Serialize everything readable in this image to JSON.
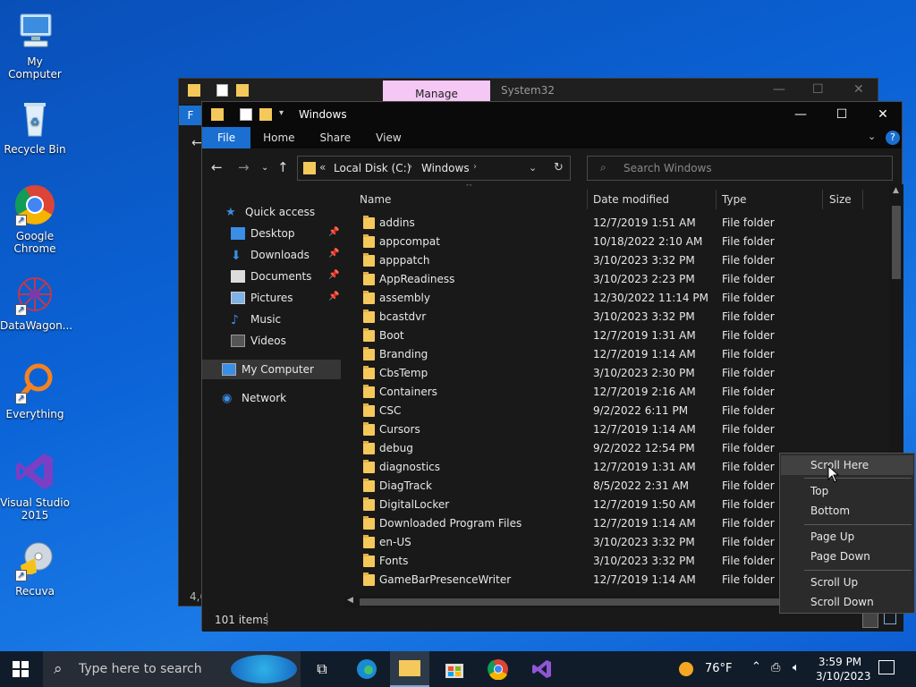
{
  "desktop": {
    "icons": [
      {
        "label": "My Computer",
        "icon": "monitor-icon"
      },
      {
        "label": "Recycle Bin",
        "icon": "recycle-bin-icon"
      },
      {
        "label": "Google Chrome",
        "icon": "chrome-icon"
      },
      {
        "label": "DataWagon...",
        "icon": "datawagon-icon"
      },
      {
        "label": "Everything",
        "icon": "everything-search-icon"
      },
      {
        "label": "Visual Studio 2015",
        "icon": "visual-studio-icon"
      },
      {
        "label": "Recuva",
        "icon": "recuva-icon"
      }
    ]
  },
  "background_window": {
    "manage_tab": "Manage",
    "title": "System32",
    "ribbon_file": "F",
    "status_fragment": "4,6"
  },
  "window": {
    "title": "Windows",
    "ribbon_tabs": [
      "File",
      "Home",
      "Share",
      "View"
    ],
    "breadcrumb": {
      "prefix": "«",
      "items": [
        "Local Disk (C:)",
        "Windows"
      ]
    },
    "search_placeholder": "Search Windows",
    "sidebar": {
      "quick_access": "Quick access",
      "quick_items": [
        "Desktop",
        "Downloads",
        "Documents",
        "Pictures",
        "Music",
        "Videos"
      ],
      "my_computer": "My Computer",
      "network": "Network"
    },
    "columns": [
      "Name",
      "Date modified",
      "Type",
      "Size"
    ],
    "rows": [
      {
        "name": "addins",
        "date": "12/7/2019 1:51 AM",
        "type": "File folder"
      },
      {
        "name": "appcompat",
        "date": "10/18/2022 2:10 AM",
        "type": "File folder"
      },
      {
        "name": "apppatch",
        "date": "3/10/2023 3:32 PM",
        "type": "File folder"
      },
      {
        "name": "AppReadiness",
        "date": "3/10/2023 2:23 PM",
        "type": "File folder"
      },
      {
        "name": "assembly",
        "date": "12/30/2022 11:14 PM",
        "type": "File folder"
      },
      {
        "name": "bcastdvr",
        "date": "3/10/2023 3:32 PM",
        "type": "File folder"
      },
      {
        "name": "Boot",
        "date": "12/7/2019 1:31 AM",
        "type": "File folder"
      },
      {
        "name": "Branding",
        "date": "12/7/2019 1:14 AM",
        "type": "File folder"
      },
      {
        "name": "CbsTemp",
        "date": "3/10/2023 2:30 PM",
        "type": "File folder"
      },
      {
        "name": "Containers",
        "date": "12/7/2019 2:16 AM",
        "type": "File folder"
      },
      {
        "name": "CSC",
        "date": "9/2/2022 6:11 PM",
        "type": "File folder"
      },
      {
        "name": "Cursors",
        "date": "12/7/2019 1:14 AM",
        "type": "File folder"
      },
      {
        "name": "debug",
        "date": "9/2/2022 12:54 PM",
        "type": "File folder"
      },
      {
        "name": "diagnostics",
        "date": "12/7/2019 1:31 AM",
        "type": "File folder"
      },
      {
        "name": "DiagTrack",
        "date": "8/5/2022 2:31 AM",
        "type": "File folder"
      },
      {
        "name": "DigitalLocker",
        "date": "12/7/2019 1:50 AM",
        "type": "File folder"
      },
      {
        "name": "Downloaded Program Files",
        "date": "12/7/2019 1:14 AM",
        "type": "File folder"
      },
      {
        "name": "en-US",
        "date": "3/10/2023 3:32 PM",
        "type": "File folder"
      },
      {
        "name": "Fonts",
        "date": "3/10/2023 3:32 PM",
        "type": "File folder"
      },
      {
        "name": "GameBarPresenceWriter",
        "date": "12/7/2019 1:14 AM",
        "type": "File folder"
      }
    ],
    "status": "101 items"
  },
  "context_menu": {
    "items": [
      "Scroll Here",
      "Top",
      "Bottom",
      "Page Up",
      "Page Down",
      "Scroll Up",
      "Scroll Down"
    ],
    "highlighted": "Scroll Here"
  },
  "taskbar": {
    "search_placeholder": "Type here to search",
    "weather": "76°F",
    "time": "3:59 PM",
    "date": "3/10/2023"
  },
  "colors": {
    "accent": "#1a6fd1",
    "folder": "#f5c85b",
    "window_bg": "#191919"
  }
}
